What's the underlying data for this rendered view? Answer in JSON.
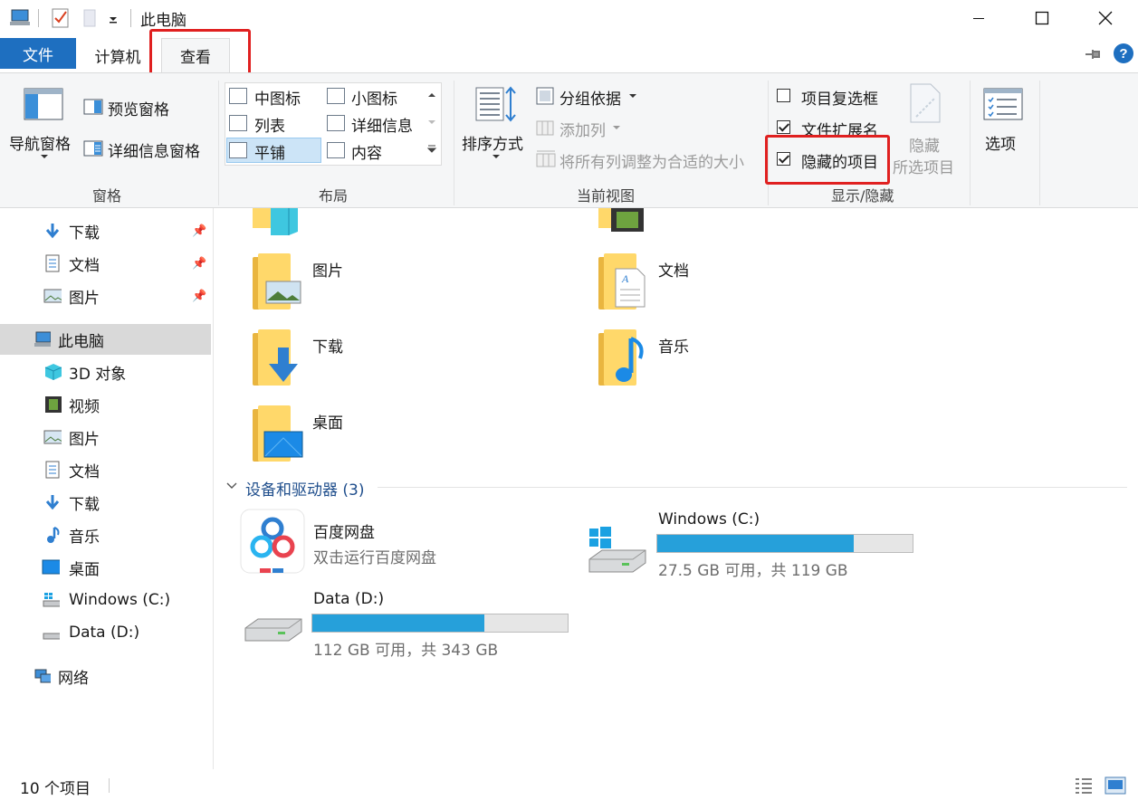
{
  "window": {
    "title": "此电脑"
  },
  "tabs": {
    "file": "文件",
    "computer": "计算机",
    "view": "查看"
  },
  "ribbon": {
    "pane": {
      "nav_pane": "导航窗格",
      "preview_pane": "预览窗格",
      "details_pane": "详细信息窗格",
      "group_label": "窗格"
    },
    "layout": {
      "medium_icons": "中图标",
      "small_icons": "小图标",
      "list": "列表",
      "details": "详细信息",
      "tiles": "平铺",
      "content": "内容",
      "group_label": "布局"
    },
    "current_view": {
      "sort_by": "排序方式",
      "group_by": "分组依据",
      "add_columns": "添加列",
      "size_all_columns": "将所有列调整为合适的大小",
      "group_label": "当前视图"
    },
    "show_hide": {
      "item_checkboxes": "项目复选框",
      "file_extensions": "文件扩展名",
      "hidden_items": "隐藏的项目",
      "hide_selected_line1": "隐藏",
      "hide_selected_line2": "所选项目",
      "group_label": "显示/隐藏",
      "item_checkboxes_checked": false,
      "file_extensions_checked": true,
      "hidden_items_checked": true
    },
    "options": "选项"
  },
  "nav": {
    "quick_access": [
      {
        "label": "下载",
        "icon": "download-arrow-icon"
      },
      {
        "label": "文档",
        "icon": "document-icon"
      },
      {
        "label": "图片",
        "icon": "picture-icon"
      }
    ],
    "this_pc": "此电脑",
    "pc_items": [
      {
        "label": "3D 对象",
        "icon": "cube-icon"
      },
      {
        "label": "视频",
        "icon": "film-icon"
      },
      {
        "label": "图片",
        "icon": "picture-icon"
      },
      {
        "label": "文档",
        "icon": "document-icon"
      },
      {
        "label": "下载",
        "icon": "download-arrow-icon"
      },
      {
        "label": "音乐",
        "icon": "music-note-icon"
      },
      {
        "label": "桌面",
        "icon": "desktop-icon"
      },
      {
        "label": "Windows (C:)",
        "icon": "windows-drive-icon"
      },
      {
        "label": "Data (D:)",
        "icon": "drive-icon"
      }
    ],
    "network": "网络"
  },
  "content": {
    "folders": [
      {
        "label": "图片"
      },
      {
        "label": "文档"
      },
      {
        "label": "下载"
      },
      {
        "label": "音乐"
      },
      {
        "label": "桌面"
      }
    ],
    "devices_section": "设备和驱动器 (3)",
    "baidu": {
      "name": "百度网盘",
      "desc": "双击运行百度网盘"
    },
    "drive_c": {
      "name": "Windows (C:)",
      "info": "27.5 GB 可用，共 119 GB",
      "used_fraction": 0.769
    },
    "drive_d": {
      "name": "Data (D:)",
      "info": "112 GB 可用，共 343 GB",
      "used_fraction": 0.673
    }
  },
  "status": {
    "item_count": "10 个项目"
  },
  "colors": {
    "accent": "#1e6fc0",
    "highlight_box": "#e02020",
    "drive_fill": "#26a0da",
    "folder": "#ffd86a"
  }
}
